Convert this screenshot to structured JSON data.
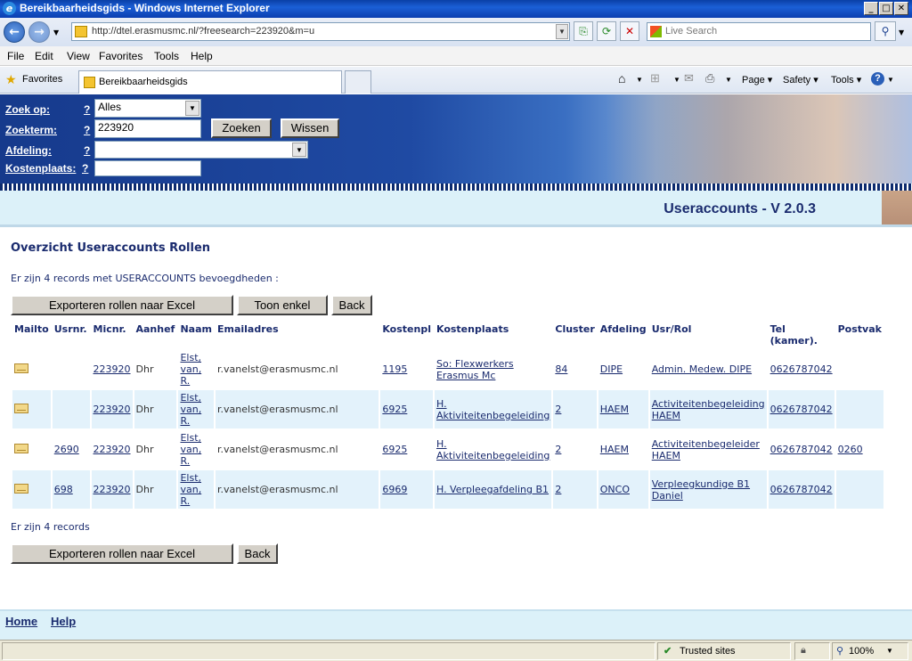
{
  "window": {
    "title": "Bereikbaarheidsgids - Windows Internet Explorer"
  },
  "browser": {
    "url": "http://dtel.erasmusmc.nl/?freesearch=223920&m=u",
    "search_placeholder": "Live Search",
    "menu": [
      "File",
      "Edit",
      "View",
      "Favorites",
      "Tools",
      "Help"
    ],
    "favorites_label": "Favorites",
    "tab_title": "Bereikbaarheidsgids",
    "commands": {
      "page": "Page",
      "safety": "Safety",
      "tools": "Tools"
    }
  },
  "search_form": {
    "zoek_op_label": "Zoek op:",
    "zoek_op_value": "Alles",
    "zoekterm_label": "Zoekterm:",
    "zoekterm_value": "223920",
    "afdeling_label": "Afdeling:",
    "afdeling_value": "",
    "kostenplaats_label": "Kostenplaats:",
    "kostenplaats_value": "",
    "help_mark": "?",
    "zoeken_button": "Zoeken",
    "wissen_button": "Wissen"
  },
  "banner": {
    "title": "Useraccounts - V 2.0.3"
  },
  "main": {
    "title": "Overzicht Useraccounts Rollen",
    "intro": "Er zijn 4 records met USERACCOUNTS bevoegdheden :",
    "export_button": "Exporteren rollen naar Excel",
    "toon_enkel_button": "Toon enkel",
    "back_button": "Back",
    "record_count": "Er zijn 4 records",
    "columns": [
      "Mailto",
      "Usrnr.",
      "Micnr.",
      "Aanhef",
      "Naam",
      "Emailadres",
      "Kostenpl",
      "Kostenplaats",
      "Cluster",
      "Afdeling",
      "Usr/Rol",
      "Tel (kamer).",
      "Postvak"
    ],
    "rows": [
      {
        "usrnr": "",
        "micnr": "223920",
        "aanhef": "Dhr",
        "naam": "Elst, van, R.",
        "email": "r.vanelst@erasmusmc.nl",
        "kostenpl": "1195",
        "kostenplaats": "So: Flexwerkers Erasmus Mc",
        "cluster": "84",
        "afdeling": "DIPE",
        "usr_rol": "Admin. Medew. DIPE",
        "tel": "0626787042",
        "postvak": ""
      },
      {
        "usrnr": "",
        "micnr": "223920",
        "aanhef": "Dhr",
        "naam": "Elst, van, R.",
        "email": "r.vanelst@erasmusmc.nl",
        "kostenpl": "6925",
        "kostenplaats": "H. Aktiviteitenbegeleiding",
        "cluster": "2",
        "afdeling": "HAEM",
        "usr_rol": "Activiteitenbegeleiding HAEM",
        "tel": "0626787042",
        "postvak": ""
      },
      {
        "usrnr": "2690",
        "micnr": "223920",
        "aanhef": "Dhr",
        "naam": "Elst, van, R.",
        "email": "r.vanelst@erasmusmc.nl",
        "kostenpl": "6925",
        "kostenplaats": "H. Aktiviteitenbegeleiding",
        "cluster": "2",
        "afdeling": "HAEM",
        "usr_rol": "Activiteitenbegeleider HAEM",
        "tel": "0626787042",
        "postvak": "0260"
      },
      {
        "usrnr": "698",
        "micnr": "223920",
        "aanhef": "Dhr",
        "naam": "Elst, van, R.",
        "email": "r.vanelst@erasmusmc.nl",
        "kostenpl": "6969",
        "kostenplaats": "H. Verpleegafdeling B1",
        "cluster": "2",
        "afdeling": "ONCO",
        "usr_rol": "Verpleegkundige B1 Daniel",
        "tel": "0626787042",
        "postvak": ""
      }
    ]
  },
  "footer": {
    "home": "Home",
    "help": "Help"
  },
  "statusbar": {
    "zone": "Trusted sites",
    "zoom": "100%"
  }
}
